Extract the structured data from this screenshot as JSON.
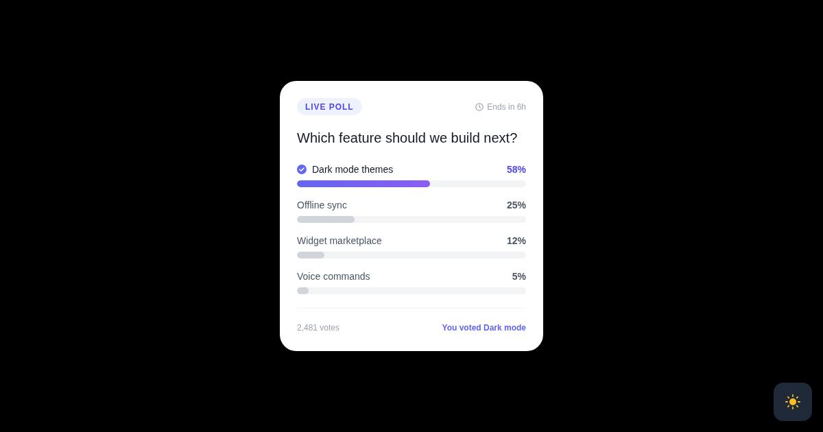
{
  "poll": {
    "badge": "LIVE POLL",
    "deadline": "Ends in 6h",
    "question": "Which feature should we build next?",
    "options": [
      {
        "label": "Dark mode themes",
        "percent": "58%",
        "level": 0.58,
        "selected": true
      },
      {
        "label": "Offline sync",
        "percent": "25%",
        "level": 0.25,
        "selected": false
      },
      {
        "label": "Widget marketplace",
        "percent": "12%",
        "level": 0.12,
        "selected": false
      },
      {
        "label": "Voice commands",
        "percent": "5%",
        "level": 0.05,
        "selected": false
      }
    ],
    "votes": "2,481 votes",
    "user_vote": "You voted Dark mode"
  }
}
